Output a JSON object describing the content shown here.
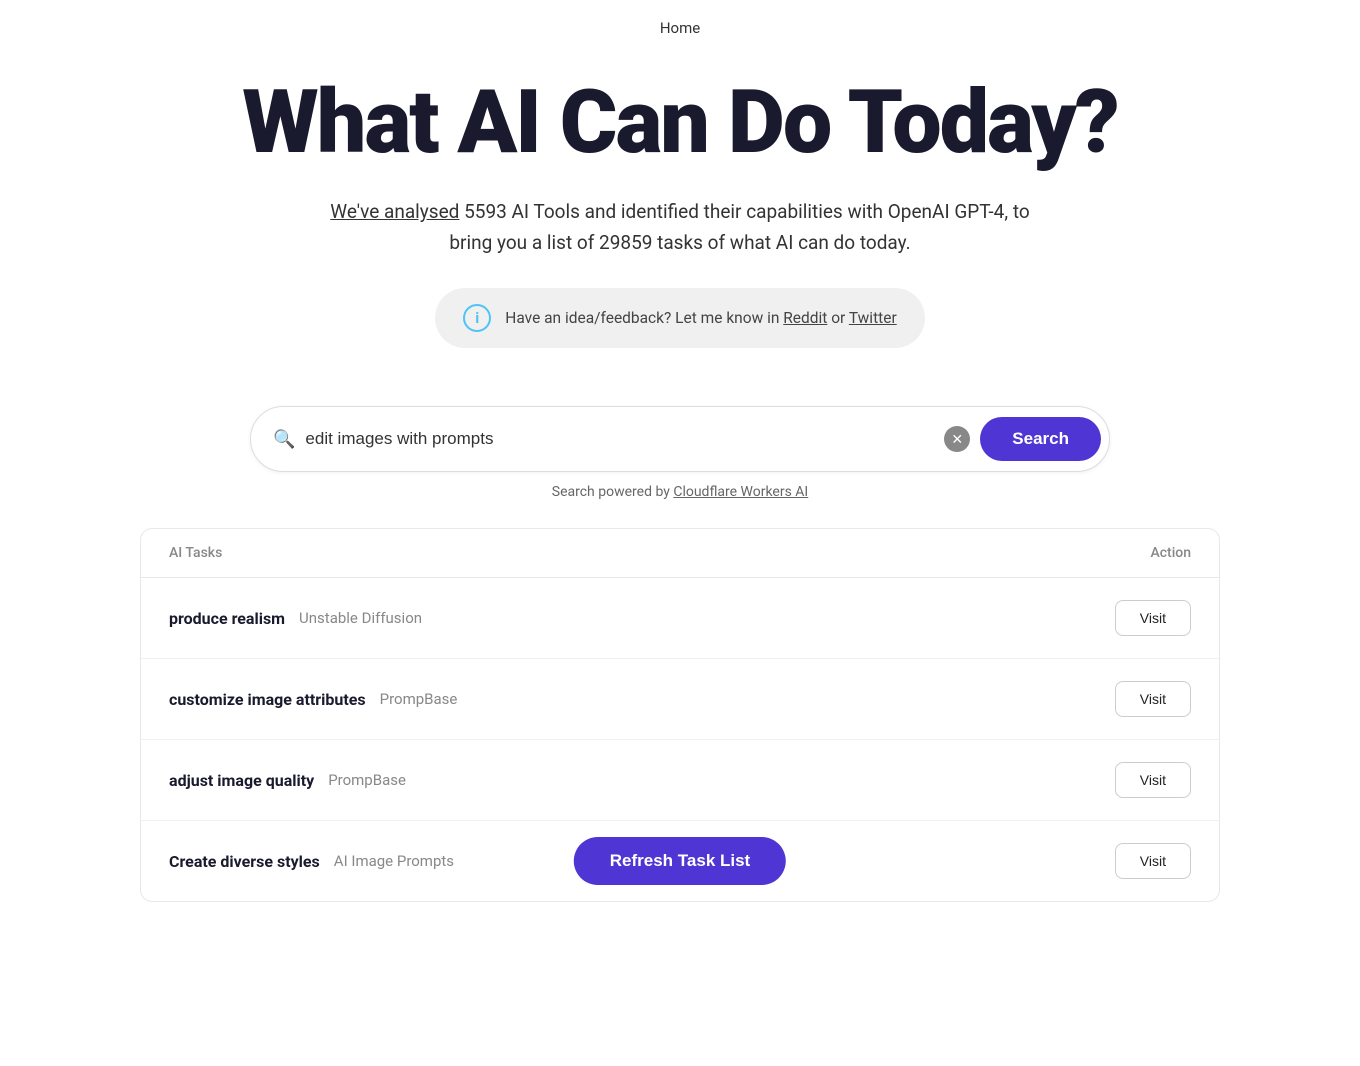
{
  "nav": {
    "home_label": "Home"
  },
  "hero": {
    "title": "What AI Can Do Today?",
    "subtitle_link": "We've analysed",
    "subtitle_text": " 5593 AI Tools and identified their capabilities with OpenAI GPT-4, to bring you a list of 29859 tasks of what AI can do today.",
    "feedback_text": "Have an idea/feedback? Let me know in ",
    "reddit_label": "Reddit",
    "twitter_label": "Twitter",
    "or_text": " or "
  },
  "search": {
    "placeholder": "edit images with prompts",
    "value": "edit images with prompts",
    "button_label": "Search",
    "powered_text": "Search powered by ",
    "powered_link": "Cloudflare Workers AI"
  },
  "table": {
    "col_tasks": "AI Tasks",
    "col_action": "Action",
    "rows": [
      {
        "task": "produce realism",
        "tool": "Unstable Diffusion",
        "action": "Visit"
      },
      {
        "task": "customize image attributes",
        "tool": "PrompBase",
        "action": "Visit"
      },
      {
        "task": "adjust image quality",
        "tool": "PrompBase",
        "action": "Visit"
      },
      {
        "task": "Create diverse styles",
        "tool": "AI Image Prompts",
        "action": "Visit"
      }
    ],
    "refresh_label": "Refresh Task List"
  },
  "colors": {
    "accent": "#4f35d4",
    "text_primary": "#1a1a2e",
    "text_muted": "#888888"
  }
}
